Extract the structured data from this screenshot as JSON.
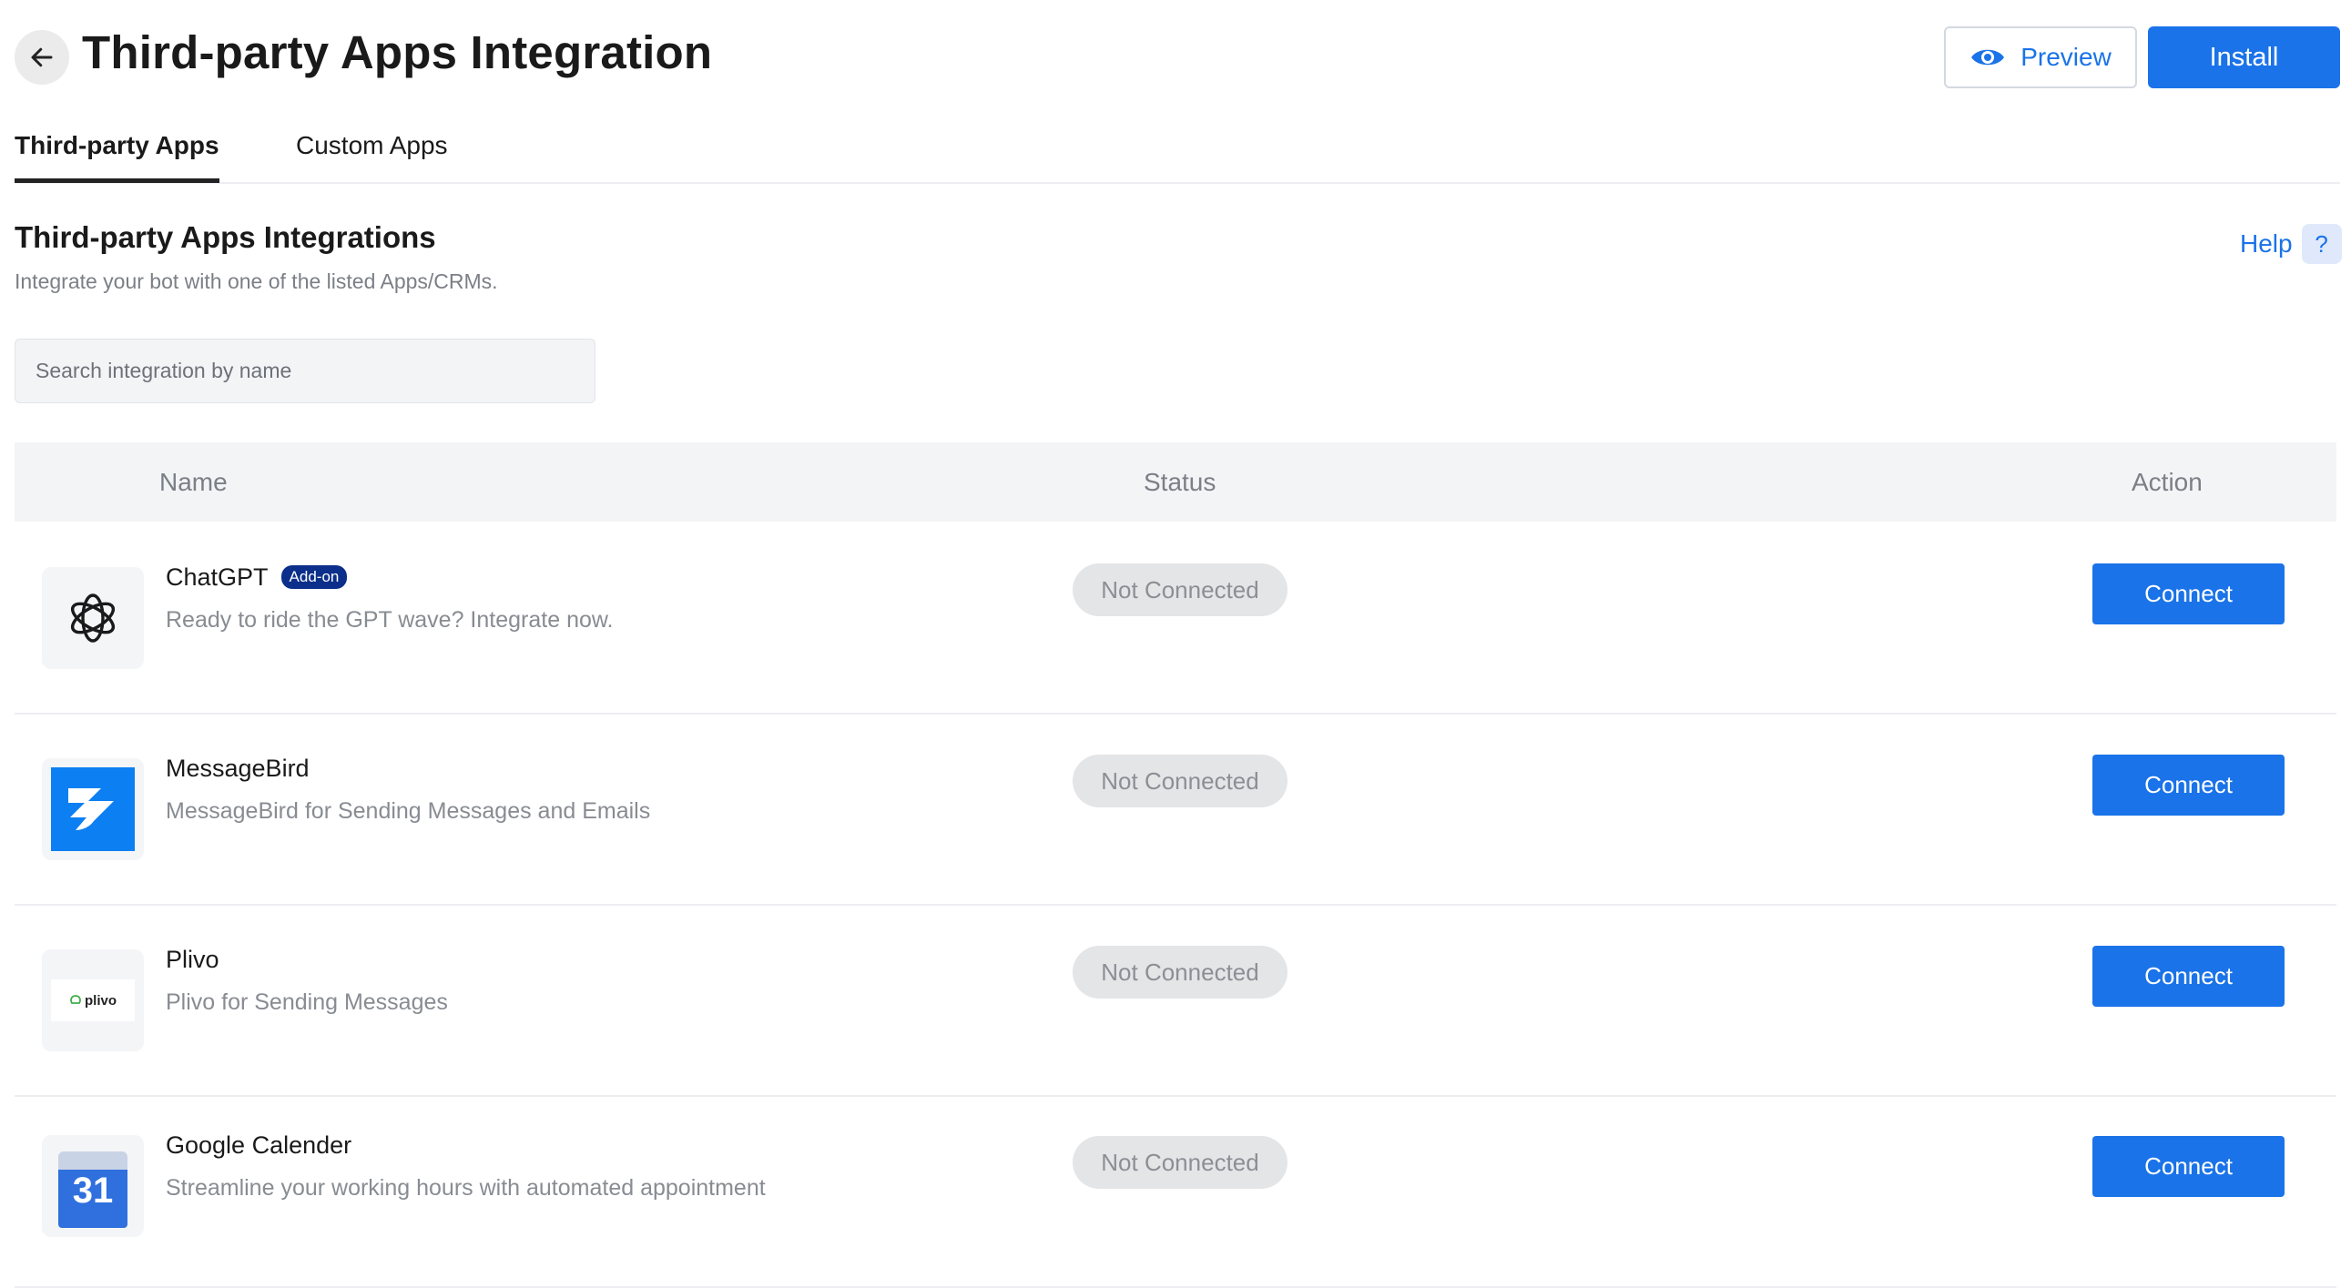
{
  "header": {
    "title": "Third-party Apps Integration",
    "preview_label": "Preview",
    "install_label": "Install"
  },
  "tabs": [
    {
      "label": "Third-party Apps",
      "active": true
    },
    {
      "label": "Custom Apps",
      "active": false
    }
  ],
  "section": {
    "title": "Third-party Apps Integrations",
    "subtitle": "Integrate your bot with one of the listed Apps/CRMs.",
    "help_label": "Help",
    "help_badge": "?"
  },
  "search": {
    "placeholder": "Search integration by name",
    "value": ""
  },
  "table": {
    "columns": [
      "Name",
      "Status",
      "Action"
    ],
    "rows": [
      {
        "name": "ChatGPT",
        "badge": "Add-on",
        "description": "Ready to ride the GPT wave? Integrate now.",
        "status": "Not Connected",
        "action": "Connect",
        "icon": "chatgpt-logo-icon"
      },
      {
        "name": "MessageBird",
        "description": "MessageBird for Sending Messages and Emails",
        "status": "Not Connected",
        "action": "Connect",
        "icon": "messagebird-logo-icon"
      },
      {
        "name": "Plivo",
        "description": "Plivo for Sending Messages",
        "status": "Not Connected",
        "action": "Connect",
        "icon": "plivo-logo-icon",
        "logo_text": "plivo"
      },
      {
        "name": "Google Calender",
        "description": "Streamline your working hours with automated appointment",
        "status": "Not Connected",
        "action": "Connect",
        "icon": "google-calendar-logo-icon",
        "logo_text": "31"
      }
    ]
  },
  "colors": {
    "primary": "#1a73e8",
    "addon_badge": "#0b2f8a",
    "status_pill": "#e4e5e7"
  }
}
